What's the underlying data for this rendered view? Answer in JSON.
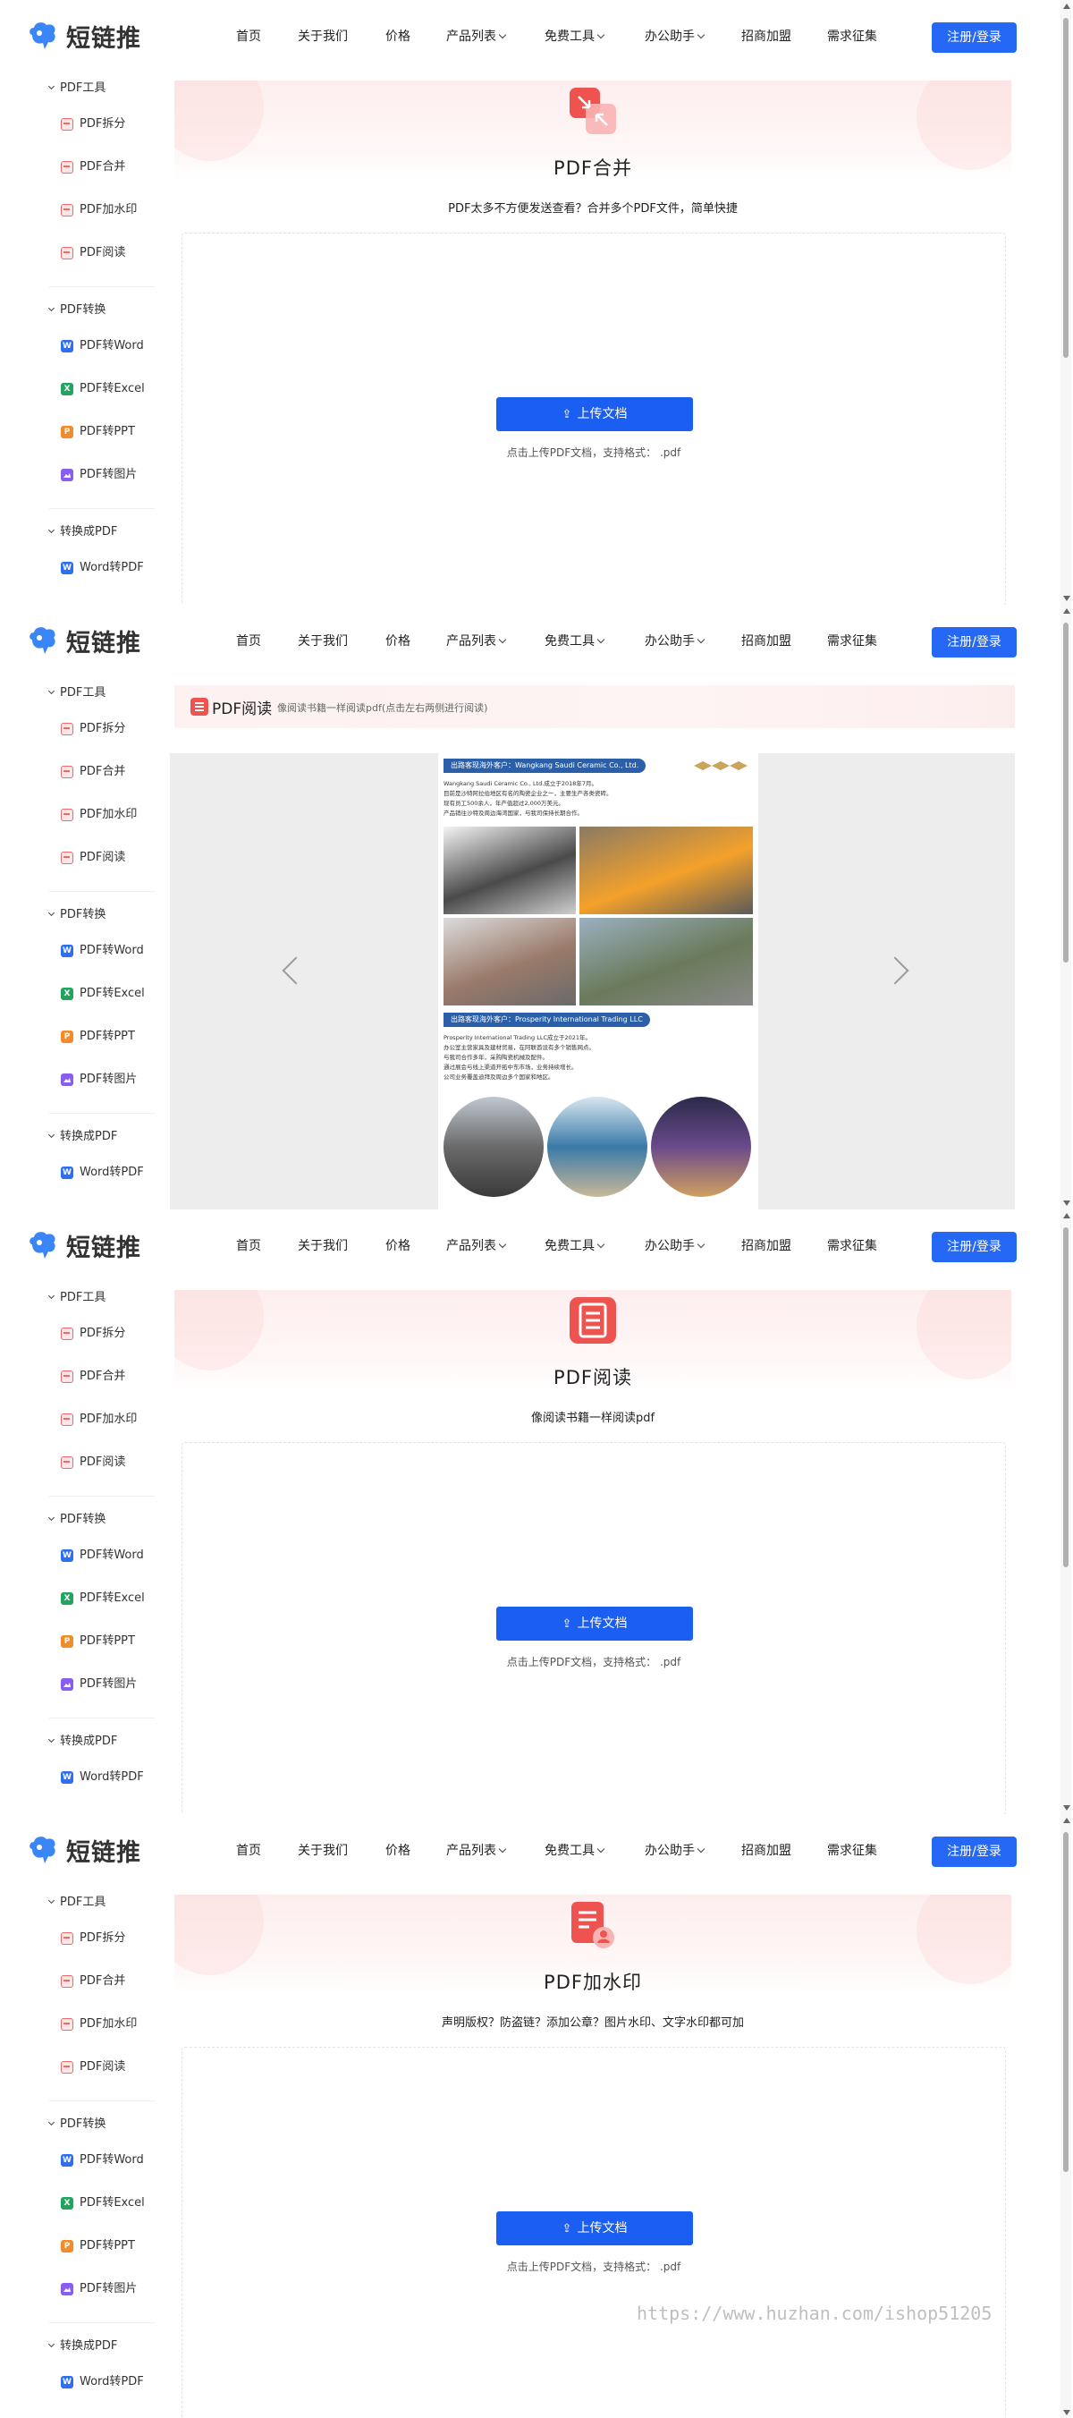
{
  "header": {
    "logo_text": "短链推",
    "nav": [
      {
        "label": "首页"
      },
      {
        "label": "关于我们"
      },
      {
        "label": "价格"
      },
      {
        "label": "产品列表"
      },
      {
        "label": "免费工具"
      },
      {
        "label": "办公助手"
      },
      {
        "label": "招商加盟"
      },
      {
        "label": "需求征集"
      }
    ],
    "login_label": "注册/登录"
  },
  "sidebar": {
    "sections": [
      {
        "title": "PDF工具",
        "items": [
          "PDF拆分",
          "PDF合并",
          "PDF加水印",
          "PDF阅读"
        ]
      },
      {
        "title": "PDF转换",
        "items": [
          "PDF转Word",
          "PDF转Excel",
          "PDF转PPT",
          "PDF转图片"
        ]
      },
      {
        "title": "转换成PDF",
        "items": [
          "Word转PDF"
        ]
      }
    ],
    "icon_letters": {
      "word": "W",
      "excel": "X",
      "ppt": "P"
    }
  },
  "colors": {
    "accent": "#1b5ff2",
    "login_bg": "#2568f5",
    "pdf_red": "#ef5350",
    "word_blue": "#2d6ff0",
    "excel_green": "#21a55e",
    "ppt_orange": "#f28b2a",
    "img_purple": "#8a5cf0"
  },
  "frames": [
    {
      "type": "tool",
      "icon": "pdf-merge-icon",
      "title": "PDF合并",
      "subtitle": "PDF太多不方便发送查看？合并多个PDF文件，简单快捷",
      "upload_label": "上传文档",
      "hint": "点击上传PDF文档，支持格式： .pdf"
    },
    {
      "type": "reader",
      "title": "PDF阅读",
      "subtitle": "像阅读书籍一样阅读pdf(点击左右两侧进行阅读)",
      "document": {
        "heading1": "出路客现海外客户：Wangkang Saudi Ceramic Co., Ltd.",
        "lines1": [
          "Wangkang Saudi Ceramic Co., Ltd.成立于2018年7月。",
          "目前是沙特阿拉伯地区有名的陶瓷企业之一，主要生产各类瓷砖。",
          "现有员工500余人，年产值超过2,000万美元。",
          "产品销往沙特及周边海湾国家，与我司保持长期合作。"
        ],
        "heading2": "出路客现海外客户：Prosperity International Trading LLC",
        "lines2": [
          "Prosperity International Trading LLC成立于2021年。",
          "办公室主营家具及建材贸易，在阿联酋设有多个销售网点。",
          "与我司合作多年，采购陶瓷机械及配件。",
          "通过展会与线上渠道开拓中东市场，业务持续增长。",
          "公司业务覆盖迪拜及周边多个国家和地区。"
        ]
      }
    },
    {
      "type": "tool",
      "icon": "pdf-read-icon",
      "title": "PDF阅读",
      "subtitle": "像阅读书籍一样阅读pdf",
      "upload_label": "上传文档",
      "hint": "点击上传PDF文档，支持格式： .pdf"
    },
    {
      "type": "tool",
      "icon": "pdf-watermark-icon",
      "title": "PDF加水印",
      "subtitle": "声明版权？防盗链？添加公章？图片水印、文字水印都可加",
      "upload_label": "上传文档",
      "hint": "点击上传PDF文档，支持格式： .pdf"
    }
  ],
  "watermark_text": "https://www.huzhan.com/ishop51205"
}
